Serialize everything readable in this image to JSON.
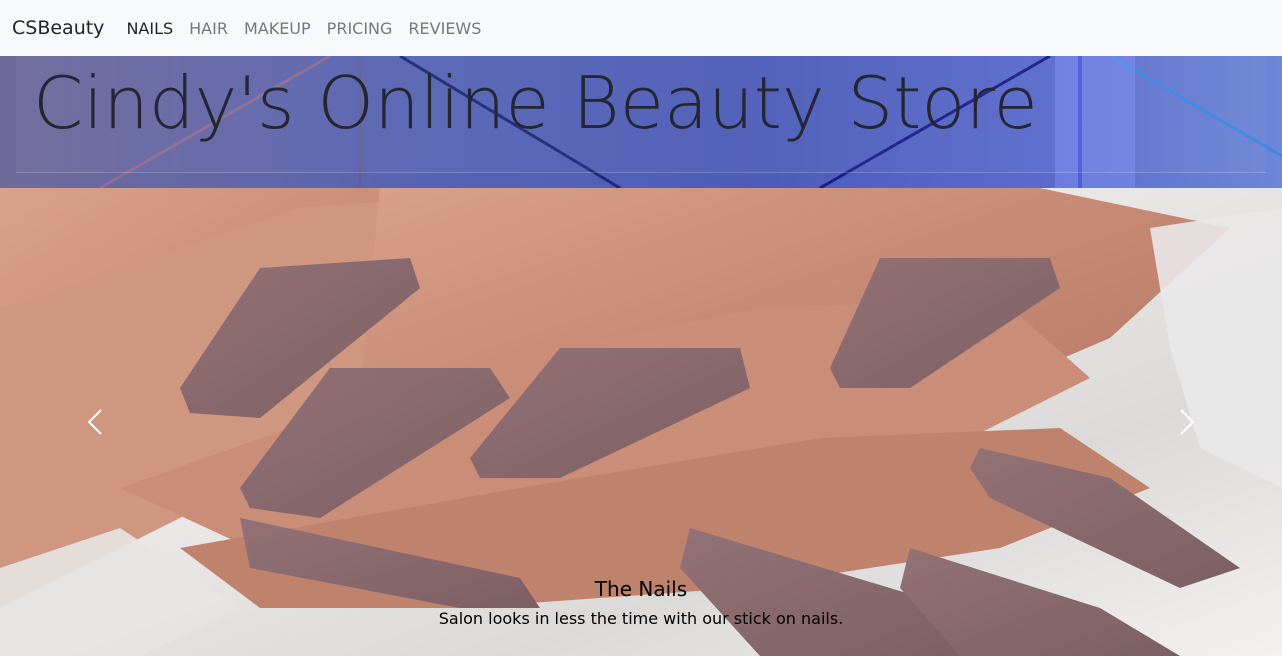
{
  "navbar": {
    "brand": "CSBeauty",
    "links": [
      {
        "label": "NAILS",
        "active": true
      },
      {
        "label": "HAIR",
        "active": false
      },
      {
        "label": "MAKEUP",
        "active": false
      },
      {
        "label": "PRICING",
        "active": false
      },
      {
        "label": "REVIEWS",
        "active": false
      }
    ]
  },
  "hero": {
    "title": "Cindy's Online Beauty Store"
  },
  "carousel": {
    "slide": {
      "title": "The Nails",
      "text": "Salon looks in less the time with our stick on nails."
    },
    "prev_icon": "chevron-left-icon",
    "next_icon": "chevron-right-icon"
  },
  "colors": {
    "navbar_bg": "#f8f9fa",
    "nav_active": "#212529",
    "nav_inactive": "#75797d",
    "hero_blue": "#4d5cb8",
    "nail_mauve": "#8a6a6f",
    "skin_tone": "#c98d78"
  }
}
